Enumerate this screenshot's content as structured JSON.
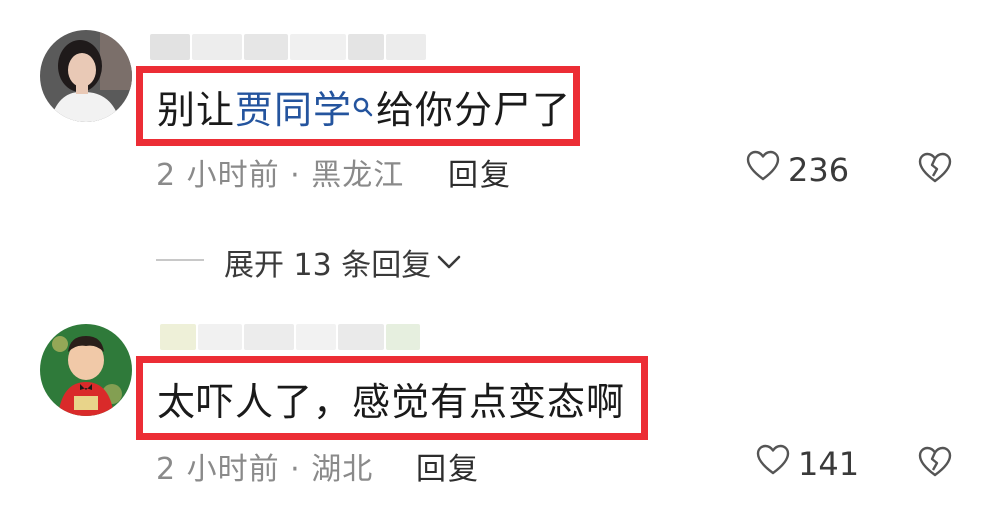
{
  "comments": [
    {
      "avatar_icon": "avatar-woman-photo",
      "text_prefix": "别让",
      "mention": "贾同学",
      "text_suffix": "给你分尸了",
      "time_location": "2 小时前 · 黑龙江",
      "reply_label": "回复",
      "likes": "236",
      "like_icon": "heart-outline-icon",
      "dislike_icon": "broken-heart-icon"
    },
    {
      "avatar_icon": "avatar-child-photo",
      "text": "太吓人了，感觉有点变态啊",
      "time_location": "2 小时前 · 湖北",
      "reply_label": "回复",
      "likes": "141",
      "like_icon": "heart-outline-icon",
      "dislike_icon": "broken-heart-icon"
    }
  ],
  "expand_replies": {
    "label": "展开 13 条回复",
    "icon": "chevron-down-icon"
  },
  "colors": {
    "highlight_border": "#ec2d35",
    "mention": "#24549e",
    "meta_text": "#8a8a8a"
  }
}
